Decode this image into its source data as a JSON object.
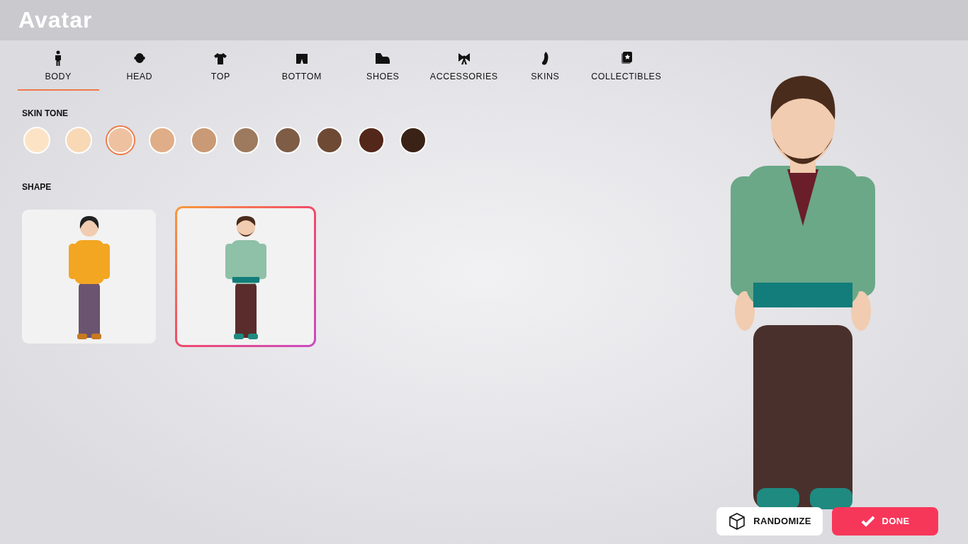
{
  "window": {
    "title": "Avatar"
  },
  "tabs": [
    {
      "label": "BODY",
      "kind": "body",
      "selected": true
    },
    {
      "label": "HEAD",
      "kind": "head",
      "selected": false
    },
    {
      "label": "TOP",
      "kind": "top",
      "selected": false
    },
    {
      "label": "BOTTOM",
      "kind": "bottom",
      "selected": false
    },
    {
      "label": "SHOES",
      "kind": "shoes",
      "selected": false
    },
    {
      "label": "ACCESSORIES",
      "kind": "accessories",
      "selected": false
    },
    {
      "label": "SKINS",
      "kind": "skins",
      "selected": false
    },
    {
      "label": "COLLECTIBLES",
      "kind": "collectibles",
      "selected": false
    }
  ],
  "skin_tone": {
    "label": "SKIN TONE",
    "swatches": [
      {
        "color": "#fde3c6",
        "selected": false
      },
      {
        "color": "#f9d8b5",
        "selected": false
      },
      {
        "color": "#eec1a0",
        "selected": true
      },
      {
        "color": "#dfae88",
        "selected": false
      },
      {
        "color": "#c99a75",
        "selected": false
      },
      {
        "color": "#9d7a5e",
        "selected": false
      },
      {
        "color": "#7e5c46",
        "selected": false
      },
      {
        "color": "#6e4a35",
        "selected": false
      },
      {
        "color": "#532719",
        "selected": false
      },
      {
        "color": "#3a2216",
        "selected": false
      }
    ]
  },
  "shape": {
    "label": "SHAPE",
    "options": [
      {
        "kind": "sweater",
        "selected": false
      },
      {
        "kind": "hoodie",
        "selected": true
      }
    ]
  },
  "buttons": [
    {
      "label": "RANDOMIZE",
      "kind": "randomize"
    },
    {
      "label": "DONE",
      "kind": "done"
    }
  ]
}
